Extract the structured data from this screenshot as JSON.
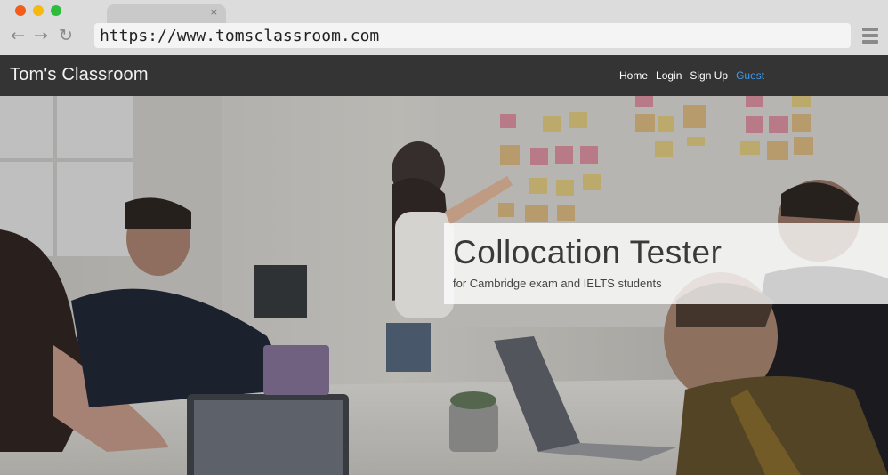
{
  "browser": {
    "url": "https://www.tomsclassroom.com",
    "tab_close": "×",
    "back_icon": "arrow-left-icon",
    "forward_icon": "arrow-right-icon",
    "reload_icon": "reload-icon",
    "menu_icon": "hamburger-menu-icon",
    "back_glyph": "←",
    "forward_glyph": "→",
    "reload_glyph": "↻"
  },
  "site": {
    "brand": "Tom's Classroom",
    "nav": {
      "home": "Home",
      "login": "Login",
      "signup": "Sign Up",
      "guest": "Guest"
    },
    "accent_color": "#3d9bf0"
  },
  "hero": {
    "title": "Collocation Tester",
    "subtitle": "for Cambridge exam and IELTS students"
  }
}
